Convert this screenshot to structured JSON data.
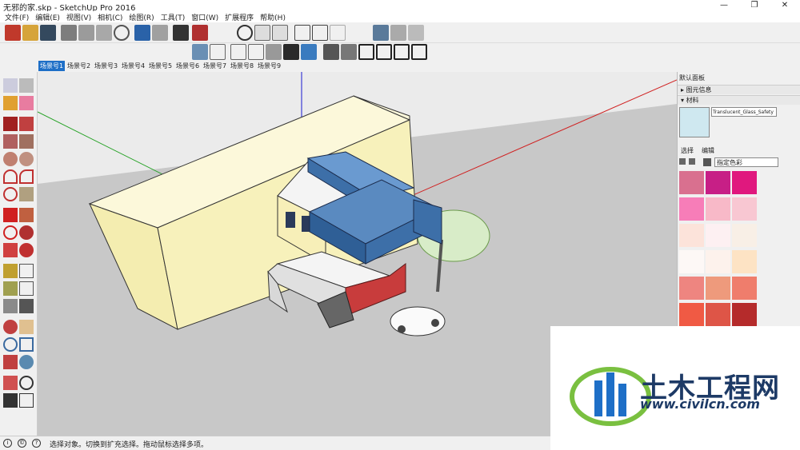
{
  "window": {
    "title": "无邪的家.skp - SketchUp Pro 2016",
    "minimize": "—",
    "maximize": "❐",
    "close": "✕"
  },
  "menu": [
    "文件(F)",
    "编辑(E)",
    "视图(V)",
    "相机(C)",
    "绘图(R)",
    "工具(T)",
    "窗口(W)",
    "扩展程序",
    "帮助(H)"
  ],
  "scene_tabs": [
    "场景号1",
    "场景号2",
    "场景号3",
    "场景号4",
    "场景号5",
    "场景号6",
    "场景号7",
    "场景号8",
    "场景号9"
  ],
  "active_scene": "场景号1",
  "tray": {
    "title": "默认面板",
    "entity_info": "图元信息",
    "materials": "材料",
    "material_name": "Translucent_Glass_Safety",
    "tab_select": "选择",
    "tab_edit": "编辑",
    "library": "指定色彩",
    "swatches": [
      "#d9708f",
      "#c71f86",
      "#e0187e",
      "#f77db8",
      "#f8b9c8",
      "#f8c7d2",
      "#fce3da",
      "#fdf0f2",
      "#f8efe6",
      "#fdf8f6",
      "#fdf2ec",
      "#fde3c4",
      "#ee8580",
      "#ee9a7c",
      "#ef7d6c",
      "#f05a44",
      "#de5547",
      "#b52b2b"
    ]
  },
  "status": {
    "message": "选择对象。切换到扩充选择。拖动鼠标选择多项。"
  },
  "watermark": {
    "title": "土木工程网",
    "url": "www.civilcn.com"
  },
  "colors": {
    "accent": "#1e6fc7",
    "wall": "#f7f1bb",
    "container_blue": "#3d6fa8",
    "container_red": "#c83c3c",
    "ground": "#c8c8c8",
    "sky": "#ebebeb"
  }
}
